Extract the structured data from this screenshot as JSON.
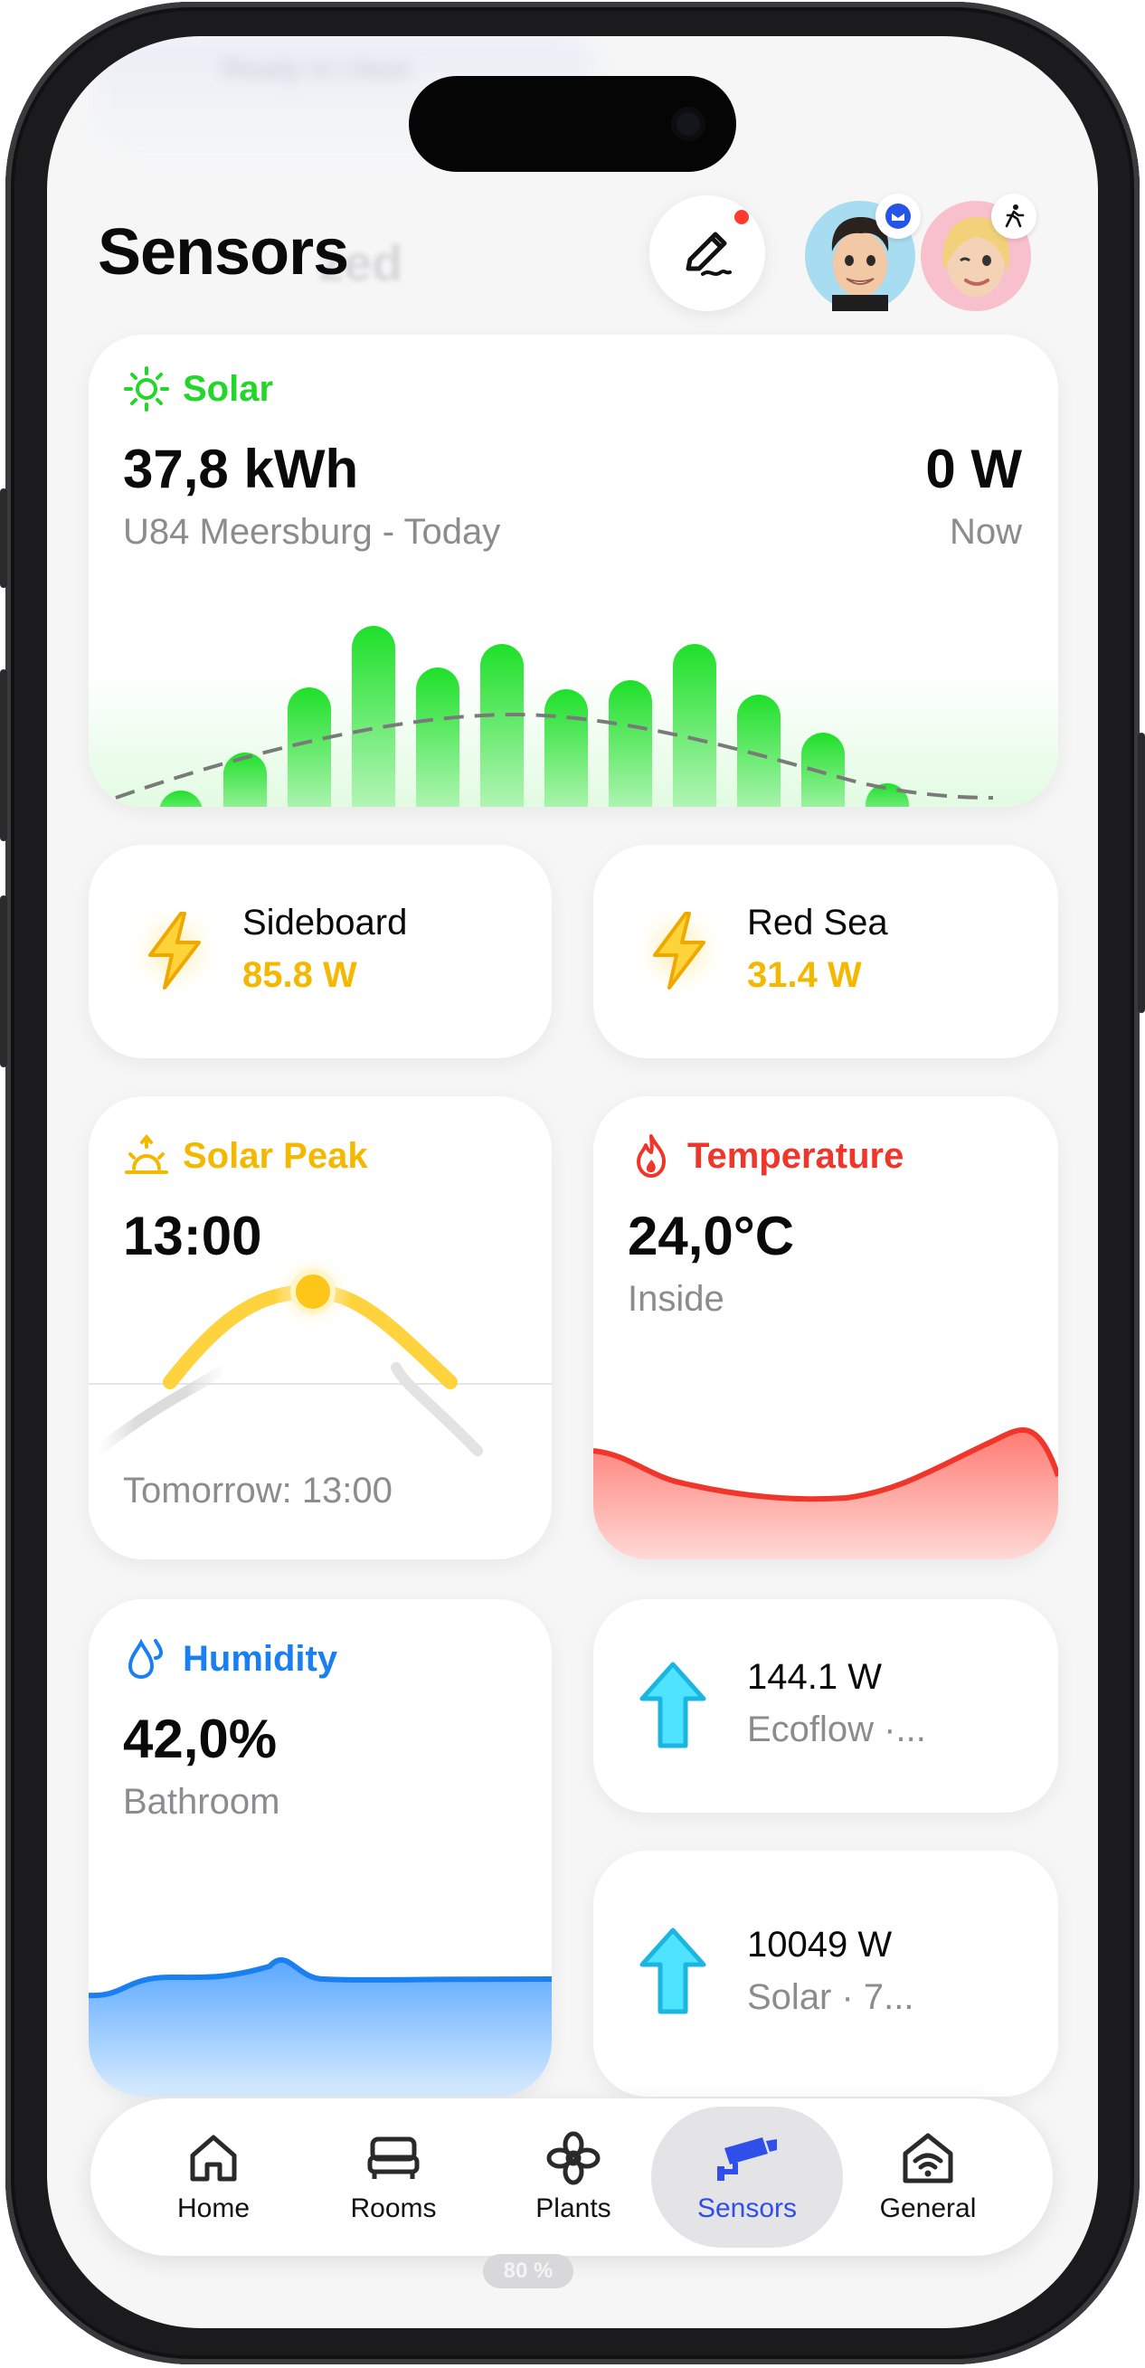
{
  "header": {
    "title": "Sensors",
    "ghost_title": "zed",
    "status_ghost": "Ready to clean"
  },
  "solar": {
    "label": "Solar",
    "energy": "37,8 kWh",
    "location": "U84 Meersburg - Today",
    "power": "0 W",
    "power_label": "Now",
    "color": "#22d62a",
    "bars": [
      0.07,
      0.3,
      0.66,
      1.0,
      0.77,
      0.9,
      0.65,
      0.7,
      0.9,
      0.62,
      0.41,
      0.13
    ]
  },
  "sideboard": {
    "name": "Sideboard",
    "value": "85.8 W",
    "icon": "lightning-icon"
  },
  "red_sea": {
    "name": "Red Sea",
    "value": "31.4 W",
    "icon": "lightning-icon"
  },
  "solar_peak": {
    "label": "Solar Peak",
    "time": "13:00",
    "tomorrow": "Tomorrow: 13:00",
    "color": "#f5b800"
  },
  "temperature": {
    "label": "Temperature",
    "value": "24,0°C",
    "location": "Inside",
    "color": "#f0362a"
  },
  "humidity": {
    "label": "Humidity",
    "value": "42,0%",
    "location": "Bathroom",
    "color": "#1a7ff0"
  },
  "ecoflow": {
    "value": "144.1 W",
    "subtitle": "Ecoflow ·..."
  },
  "solar_flow": {
    "value": "10049 W",
    "subtitle": "Solar · 7..."
  },
  "tabs": [
    {
      "label": "Home",
      "icon": "home-icon"
    },
    {
      "label": "Rooms",
      "icon": "bed-icon"
    },
    {
      "label": "Plants",
      "icon": "plant-icon"
    },
    {
      "label": "Sensors",
      "icon": "camera-icon",
      "active": true
    },
    {
      "label": "General",
      "icon": "wifi-house-icon"
    }
  ],
  "home_indicator": "80 %"
}
